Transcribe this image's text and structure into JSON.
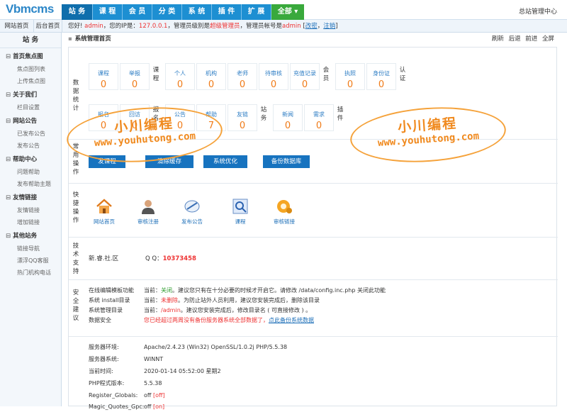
{
  "brand": {
    "logo": "Vbmcms",
    "title": "总站管理中心"
  },
  "nav": [
    "站 务",
    "课 程",
    "会 员",
    "分 类",
    "系 统",
    "插 件",
    "扩 展",
    "全部 ▾"
  ],
  "bar": {
    "tab1": "网站首页",
    "tab2": "后台首页",
    "w1": "您好! ",
    "user": "admin",
    "w2": "，您的IP是：",
    "ip": "127.0.0.1",
    "w3": "，管理员级别是",
    "level": "超级管理员",
    "w4": "，管理员帐号是",
    "acct": "admin",
    "w5": " [",
    "edit": "改密",
    "w6": "，",
    "logout": "注销",
    "w7": "]"
  },
  "sidebar": {
    "head": "站 务",
    "groups": [
      {
        "label": "首页焦点图",
        "items": [
          "焦点图列表",
          "上传焦点图"
        ]
      },
      {
        "label": "关于我们",
        "items": [
          "栏目设置"
        ]
      },
      {
        "label": "网站公告",
        "items": [
          "已发布公告",
          "发布公告"
        ]
      },
      {
        "label": "帮助中心",
        "items": [
          "问题帮助",
          "发布帮助主题"
        ]
      },
      {
        "label": "友情链接",
        "items": [
          "友情链接",
          "增加链接"
        ]
      },
      {
        "label": "其他站务",
        "items": [
          "链接导航",
          "漂浮QQ客服",
          "热门机构电话"
        ]
      }
    ]
  },
  "main": {
    "title": "系统管理首页",
    "tools": "刷新 后退 前进 全屏"
  },
  "stats": {
    "label": "数据统计",
    "g_course": "课程",
    "g_member": "会员",
    "g_cert": "认证",
    "g_report": "报名",
    "g_station": "站务",
    "g_plugin": "插件",
    "items": [
      {
        "l": "课程",
        "v": "0"
      },
      {
        "l": "举报",
        "v": "0"
      },
      {
        "l": "个人",
        "v": "0"
      },
      {
        "l": "机构",
        "v": "0"
      },
      {
        "l": "老师",
        "v": "0"
      },
      {
        "l": "待审核",
        "v": "0"
      },
      {
        "l": "充值记录",
        "v": "0"
      },
      {
        "l": "执照",
        "v": "0"
      },
      {
        "l": "身份证",
        "v": "0"
      },
      {
        "l": "报名",
        "v": "0"
      },
      {
        "l": "回访",
        "v": "0"
      },
      {
        "l": "公告",
        "v": "0"
      },
      {
        "l": "帮助",
        "v": "7"
      },
      {
        "l": "友链",
        "v": "0"
      },
      {
        "l": "新闻",
        "v": "0"
      },
      {
        "l": "需求",
        "v": "0"
      }
    ]
  },
  "common": {
    "label": "常用操作",
    "buttons": [
      "发课程",
      "清除缓存",
      "系统优化",
      "备份数据库"
    ]
  },
  "quick": {
    "label": "快捷操作",
    "items": [
      "网站首页",
      "审核注册",
      "发布公告",
      "课程",
      "审核链接"
    ]
  },
  "support": {
    "label": "技术支持",
    "name": "新.睿.社.区",
    "qq_label": "Q Q：",
    "qq": "10373458"
  },
  "security": {
    "label": "安全建议",
    "rows": [
      {
        "k": "在线编辑模板功能",
        "a": "当前：",
        "s": "关闭",
        "c": "。建议您只有在十分必要的时候才开启它。请修改 /data/config.inc.php 关闭此功能"
      },
      {
        "k": "系统 install目录",
        "a": "当前：",
        "s": "未删除",
        "c": "。为防止站外人员利用，建议您安装完成后，删除该目录"
      },
      {
        "k": "系统管理目录",
        "a": "当前：",
        "s": "/admin",
        "c": "。建议您安装完成后，修改目录名 ( 可直接修改 ) 。"
      },
      {
        "k": "数据安全",
        "a": "",
        "s": "您已经超过两周没有备份服务器系统全部数据了，",
        "c": "点此备份系统数据"
      }
    ]
  },
  "server": {
    "rows": [
      {
        "k": "服务器环境:",
        "v": "Apache/2.4.23 (Win32) OpenSSL/1.0.2j PHP/5.5.38",
        "x": ""
      },
      {
        "k": "服务器系统:",
        "v": "WINNT",
        "x": ""
      },
      {
        "k": "当前时间:",
        "v": "2020-01-14 05:52:00 星期2",
        "x": ""
      },
      {
        "k": "PHP程式版本:",
        "v": "5.5.38",
        "x": ""
      },
      {
        "k": "Register_Globals:",
        "v": "off",
        "x": "[off]"
      },
      {
        "k": "Magic_Quotes_Gpc:",
        "v": "off",
        "x": "[on]"
      }
    ]
  },
  "watermark": {
    "line1": "小川编程",
    "line2": "www.youhutong.com"
  }
}
